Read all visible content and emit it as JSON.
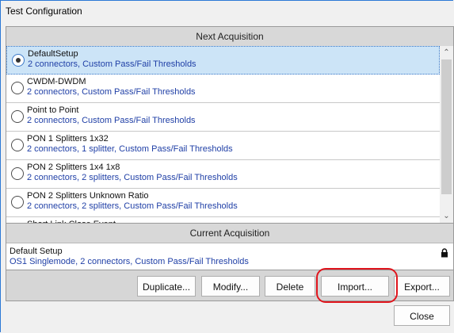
{
  "window": {
    "title": "Test Configuration"
  },
  "next_acquisition": {
    "header": "Next Acquisition",
    "items": [
      {
        "name": "DefaultSetup",
        "desc": "2 connectors, Custom Pass/Fail Thresholds",
        "selected": true
      },
      {
        "name": "CWDM-DWDM",
        "desc": "2 connectors, Custom Pass/Fail Thresholds",
        "selected": false
      },
      {
        "name": "Point to Point",
        "desc": "2 connectors, Custom Pass/Fail Thresholds",
        "selected": false
      },
      {
        "name": "PON 1 Splitters 1x32",
        "desc": "2 connectors, 1 splitter, Custom Pass/Fail Thresholds",
        "selected": false
      },
      {
        "name": "PON 2 Splitters 1x4 1x8",
        "desc": "2 connectors, 2 splitters, Custom Pass/Fail Thresholds",
        "selected": false
      },
      {
        "name": "PON 2 Splitters Unknown Ratio",
        "desc": "2 connectors, 2 splitters, Custom Pass/Fail Thresholds",
        "selected": false
      },
      {
        "name": "Short Link Close Event",
        "desc": "",
        "selected": false
      }
    ]
  },
  "current_acquisition": {
    "header": "Current Acquisition",
    "name": "Default Setup",
    "desc": "OS1 Singlemode, 2 connectors, Custom Pass/Fail Thresholds",
    "lock_icon": "lock-icon"
  },
  "buttons": {
    "duplicate": "Duplicate...",
    "modify": "Modify...",
    "delete": "Delete",
    "import": "Import...",
    "export": "Export...",
    "close": "Close"
  },
  "colors": {
    "selection": "#cce4f7",
    "description_text": "#1f3fa6",
    "highlight": "#e0141c",
    "window_border": "#2b78d6"
  }
}
